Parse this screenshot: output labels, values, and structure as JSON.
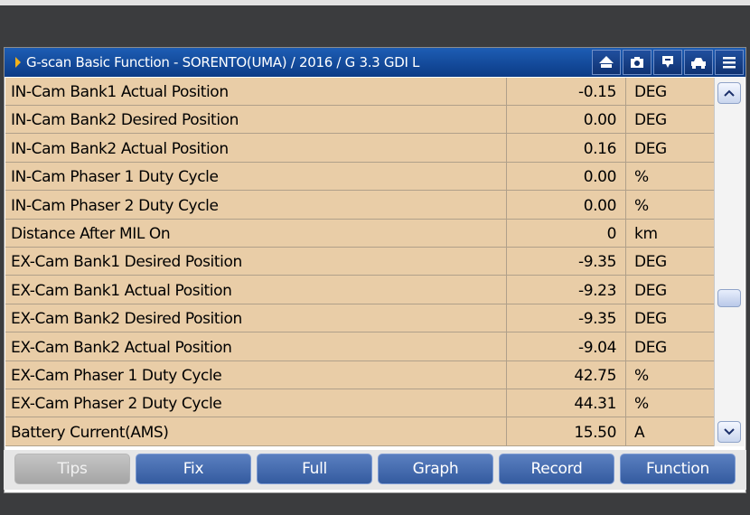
{
  "window": {
    "title": "G-scan Basic Function - SORENTO(UMA) / 2016 / G 3.3 GDI L",
    "toolbar_icons": [
      "home-icon",
      "camera-icon",
      "comment-icon",
      "vehicle-icon",
      "menu-icon"
    ]
  },
  "table": {
    "rows": [
      {
        "name": "IN-Cam Bank1 Actual Position",
        "value": "-0.15",
        "unit": "DEG"
      },
      {
        "name": "IN-Cam Bank2 Desired Position",
        "value": "0.00",
        "unit": "DEG"
      },
      {
        "name": "IN-Cam Bank2 Actual Position",
        "value": "0.16",
        "unit": "DEG"
      },
      {
        "name": "IN-Cam Phaser 1 Duty Cycle",
        "value": "0.00",
        "unit": "%"
      },
      {
        "name": "IN-Cam Phaser 2 Duty Cycle",
        "value": "0.00",
        "unit": "%"
      },
      {
        "name": "Distance After MIL On",
        "value": "0",
        "unit": "km"
      },
      {
        "name": "EX-Cam Bank1 Desired Position",
        "value": "-9.35",
        "unit": "DEG"
      },
      {
        "name": "EX-Cam Bank1 Actual Position",
        "value": "-9.23",
        "unit": "DEG"
      },
      {
        "name": "EX-Cam Bank2 Desired Position",
        "value": "-9.35",
        "unit": "DEG"
      },
      {
        "name": "EX-Cam Bank2 Actual Position",
        "value": "-9.04",
        "unit": "DEG"
      },
      {
        "name": "EX-Cam Phaser 1 Duty Cycle",
        "value": "42.75",
        "unit": "%"
      },
      {
        "name": "EX-Cam Phaser 2 Duty Cycle",
        "value": "44.31",
        "unit": "%"
      },
      {
        "name": "Battery Current(AMS)",
        "value": "15.50",
        "unit": "A"
      }
    ]
  },
  "buttons": {
    "tips": "Tips",
    "fix": "Fix",
    "full": "Full",
    "graph": "Graph",
    "record": "Record",
    "function": "Function"
  },
  "colors": {
    "title_bar": "#1d5db4",
    "row_bg": "#e9cda7",
    "button": "#4a6fb0",
    "button_disabled": "#b5b5b5",
    "accent_arrow": "#f2b11a"
  }
}
